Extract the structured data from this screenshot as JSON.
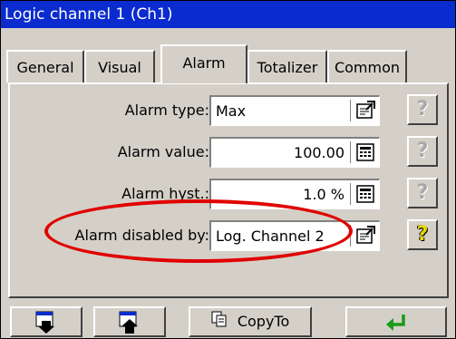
{
  "window": {
    "title": "Logic channel 1 (Ch1)"
  },
  "tabs": [
    {
      "label": "General",
      "active": false
    },
    {
      "label": "Visual",
      "active": false
    },
    {
      "label": "Alarm",
      "active": true
    },
    {
      "label": "Totalizer",
      "active": false
    },
    {
      "label": "Common",
      "active": false
    }
  ],
  "form": {
    "alarm_type": {
      "label": "Alarm type:",
      "value": "Max",
      "icon": "select-list-icon"
    },
    "alarm_value": {
      "label": "Alarm value:",
      "value": "100.00",
      "icon": "keypad-icon"
    },
    "alarm_hyst": {
      "label": "Alarm hyst.:",
      "value": "1.0 %",
      "icon": "keypad-icon"
    },
    "alarm_disabled_by": {
      "label": "Alarm disabled by:",
      "value": "Log. Channel 2",
      "icon": "select-list-icon"
    }
  },
  "help": {
    "icon": "help-question-icon"
  },
  "bottombar": {
    "move_down_icon": "window-arrow-down-icon",
    "move_up_icon": "window-arrow-up-icon",
    "copy_label": "CopyTo",
    "enter_icon": "enter-arrow-icon"
  },
  "colors": {
    "titlebar": "#0a2ccf",
    "panel": "#d4d0c8",
    "highlight_ellipse": "#e00000",
    "help_active": "#e6d800",
    "enter_arrow": "#1a9a1a"
  }
}
